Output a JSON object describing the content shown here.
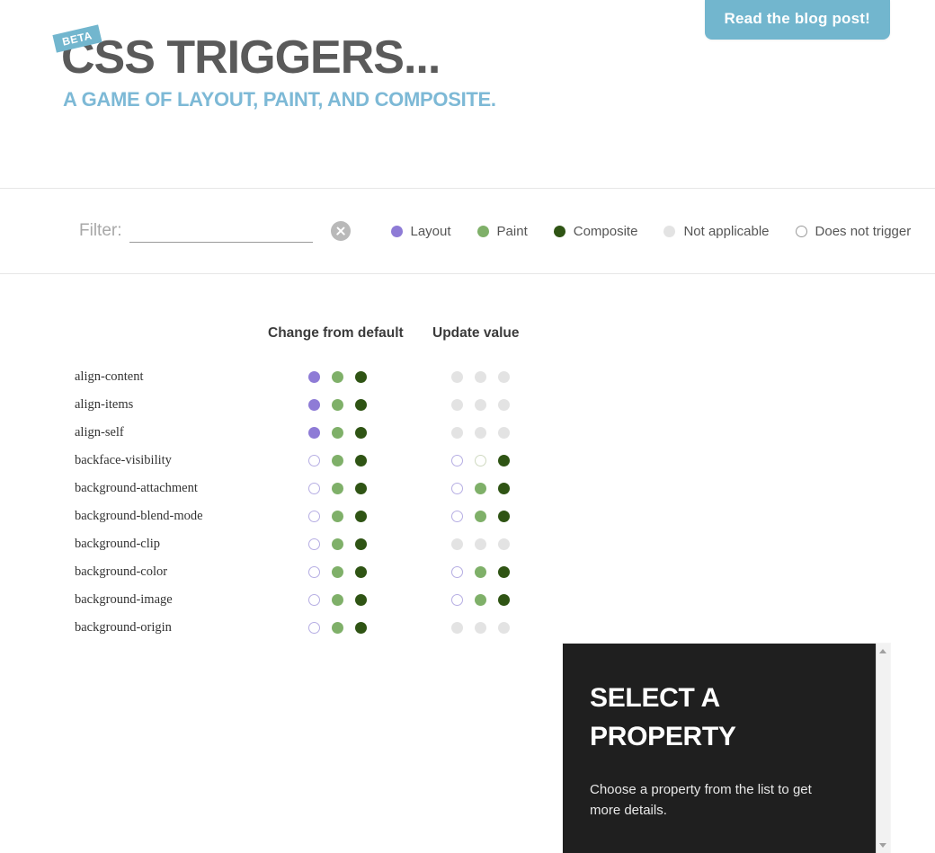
{
  "header": {
    "beta_badge": "BETA",
    "title": "CSS TRIGGERS...",
    "subtitle": "A GAME OF LAYOUT, PAINT, AND COMPOSITE.",
    "blog_button": "Read the blog post!",
    "accent_color": "#72b6ce",
    "title_color": "#5a5a5a"
  },
  "filter": {
    "label": "Filter:",
    "value": "",
    "placeholder": "",
    "clear_icon": "clear-circle-icon"
  },
  "legend": [
    {
      "label": "Layout",
      "state": "layout",
      "color": "#8e7bd6"
    },
    {
      "label": "Paint",
      "state": "paint",
      "color": "#7fb069"
    },
    {
      "label": "Composite",
      "state": "composite",
      "color": "#2f5414"
    },
    {
      "label": "Not applicable",
      "state": "na",
      "color": "#e3e3e3"
    },
    {
      "label": "Does not trigger",
      "state": "no-layout",
      "color": "#ffffff"
    }
  ],
  "table": {
    "columns": [
      {
        "label": "Change from default",
        "key": "change"
      },
      {
        "label": "Update value",
        "key": "update"
      }
    ],
    "rows": [
      {
        "property": "align-content",
        "change": [
          "layout",
          "paint",
          "composite"
        ],
        "update": [
          "na",
          "na",
          "na"
        ]
      },
      {
        "property": "align-items",
        "change": [
          "layout",
          "paint",
          "composite"
        ],
        "update": [
          "na",
          "na",
          "na"
        ]
      },
      {
        "property": "align-self",
        "change": [
          "layout",
          "paint",
          "composite"
        ],
        "update": [
          "na",
          "na",
          "na"
        ]
      },
      {
        "property": "backface-visibility",
        "change": [
          "no-layout",
          "paint",
          "composite"
        ],
        "update": [
          "no-layout",
          "no-paint",
          "composite"
        ]
      },
      {
        "property": "background-attachment",
        "change": [
          "no-layout",
          "paint",
          "composite"
        ],
        "update": [
          "no-layout",
          "paint",
          "composite"
        ]
      },
      {
        "property": "background-blend-mode",
        "change": [
          "no-layout",
          "paint",
          "composite"
        ],
        "update": [
          "no-layout",
          "paint",
          "composite"
        ]
      },
      {
        "property": "background-clip",
        "change": [
          "no-layout",
          "paint",
          "composite"
        ],
        "update": [
          "na",
          "na",
          "na"
        ]
      },
      {
        "property": "background-color",
        "change": [
          "no-layout",
          "paint",
          "composite"
        ],
        "update": [
          "no-layout",
          "paint",
          "composite"
        ]
      },
      {
        "property": "background-image",
        "change": [
          "no-layout",
          "paint",
          "composite"
        ],
        "update": [
          "no-layout",
          "paint",
          "composite"
        ]
      },
      {
        "property": "background-origin",
        "change": [
          "no-layout",
          "paint",
          "composite"
        ],
        "update": [
          "na",
          "na",
          "na"
        ]
      }
    ]
  },
  "detail_panel": {
    "title": "SELECT A PROPERTY",
    "description": "Choose a property from the list to get more details.",
    "background_color": "#1f1f1f"
  }
}
